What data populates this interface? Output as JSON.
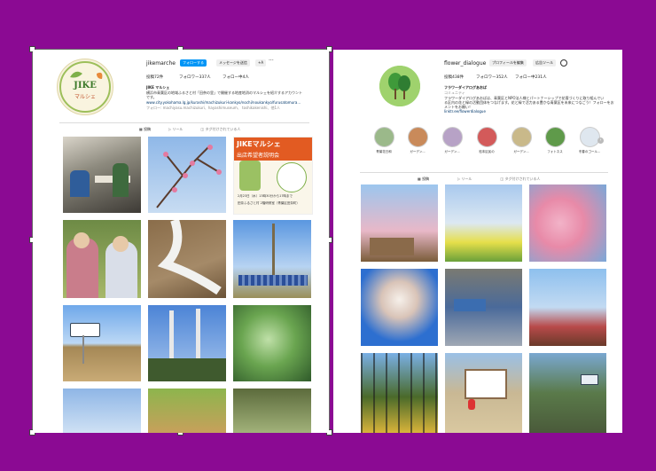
{
  "left_profile": {
    "username": "jikemarche",
    "follow_label": "フォローする",
    "message_label": "メッセージを送信",
    "add_label": "+A",
    "more_label": "···",
    "stats": {
      "posts": "投稿72件",
      "followers": "フォロワー337人",
      "following": "フォロー中4人"
    },
    "bio_name": "JIKE マルシェ",
    "bio_lines": [
      "横浜市青葉区の地域ふるさと村「田奈の里」で開催する地産地消のマルシェを紹介するアカウント",
      "です。"
    ],
    "bio_link": "www.city.yokohama.lg.jp/kurashi/machizukuri-kankyo/nochi/noukankyo/furusatomura...",
    "followed_by": "フォロー: machiyasu.machizukuri、hayashimuseum、 toshikakenishi、他1人",
    "tabs": [
      "投稿",
      "リール",
      "タグ付けされている人"
    ],
    "avatar_text": "JIKE",
    "avatar_sub": "マルシェ",
    "poster_title": "JIKEマルシェ",
    "poster_subtitle": "出店希望者説明会",
    "poster_date": "2月23日（水）13時30分から17時まで",
    "poster_detail": "田奈ふるさと村 2階研修室（青葉区田奈町）"
  },
  "right_profile": {
    "username": "flower_dialogue",
    "edit_label": "プロフィールを編集",
    "ads_label": "広告ツール",
    "stats": {
      "posts": "投稿438件",
      "followers": "フォロワー352人",
      "following": "フォロー中231人"
    },
    "bio_name": "フラワーダイアログあおば",
    "bio_category": "コミュニティ",
    "bio_lines": [
      "フラワーダイアログあおばは、青葉区とNPO法人様とパートナーシップで花壇づくりに取り組んでい",
      "る区内の花と緑の活動団体をつなげます。花と緑で活力ある豊かな青葉区を未来につなごう！フォローをお",
      "メントをお願い！"
    ],
    "bio_link": "linktr.ee/flowerdialogue",
    "highlights": [
      "青葉花日和",
      "ガーデン...",
      "ガーデン...",
      "松本区民の",
      "ガーデン...",
      "フォトネス",
      "冬春のゴール..."
    ],
    "tabs": [
      "投稿",
      "リール",
      "タグ付けされている人"
    ]
  }
}
